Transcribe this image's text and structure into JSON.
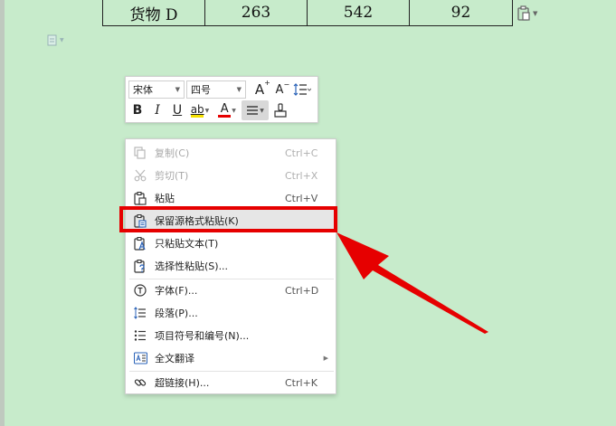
{
  "table": {
    "row": [
      "货物 D",
      "263",
      "542",
      "92"
    ]
  },
  "mini_toolbar": {
    "font_name": "宋体",
    "font_size": "四号",
    "bold": "B",
    "italic": "I",
    "underline": "U",
    "font_color_letter": "A",
    "grow_font": "A",
    "shrink_font": "A",
    "highlight_text": "ab"
  },
  "context_menu": {
    "items": [
      {
        "label": "复制(C)",
        "shortcut": "Ctrl+C",
        "icon": "copy-icon",
        "disabled": true
      },
      {
        "label": "剪切(T)",
        "shortcut": "Ctrl+X",
        "icon": "cut-icon",
        "disabled": true
      },
      {
        "label": "粘贴",
        "shortcut": "Ctrl+V",
        "icon": "paste-icon",
        "disabled": false
      },
      {
        "label": "保留源格式粘贴(K)",
        "shortcut": "",
        "icon": "paste-keep-format-icon",
        "disabled": false,
        "highlighted": true
      },
      {
        "label": "只粘贴文本(T)",
        "shortcut": "",
        "icon": "paste-text-only-icon",
        "disabled": false
      },
      {
        "label": "选择性粘贴(S)...",
        "shortcut": "",
        "icon": "paste-special-icon",
        "disabled": false
      },
      {
        "label": "字体(F)...",
        "shortcut": "Ctrl+D",
        "icon": "font-icon",
        "disabled": false
      },
      {
        "label": "段落(P)...",
        "shortcut": "",
        "icon": "paragraph-icon",
        "disabled": false
      },
      {
        "label": "项目符号和编号(N)...",
        "shortcut": "",
        "icon": "bullets-icon",
        "disabled": false
      },
      {
        "label": "全文翻译",
        "shortcut": "",
        "icon": "translate-icon",
        "disabled": false,
        "submenu": true
      },
      {
        "label": "超链接(H)...",
        "shortcut": "Ctrl+K",
        "icon": "hyperlink-icon",
        "disabled": false
      }
    ]
  },
  "colors": {
    "page_bg": "#c7ebcb",
    "highlight": "#e60000",
    "highlighter_yellow": "#f5e100",
    "font_color_red": "#e60000"
  }
}
